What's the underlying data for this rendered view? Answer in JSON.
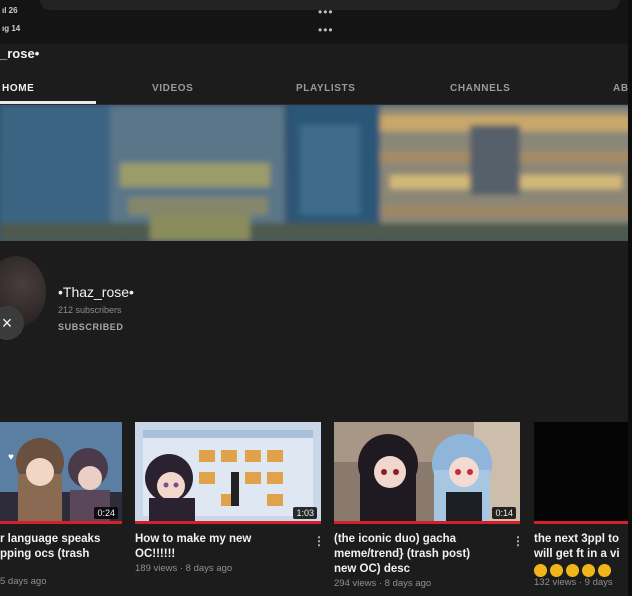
{
  "status": {
    "line1": "ıl 26",
    "line2": "ıg 14",
    "more_label": "•••"
  },
  "channel": {
    "header_title": "_rose•",
    "name": "•Thaz_rose•",
    "subscribers": "212 subscribers",
    "subscription_state": "SUBSCRIBED"
  },
  "tabs": [
    {
      "label": "HOME",
      "active": true
    },
    {
      "label": "VIDEOS",
      "active": false
    },
    {
      "label": "PLAYLISTS",
      "active": false
    },
    {
      "label": "CHANNELS",
      "active": false
    },
    {
      "label": "AB",
      "active": false
    }
  ],
  "close_icon": "×",
  "videos": [
    {
      "title_line1": "r language speaks",
      "title_line2": "pping ocs (trash",
      "meta": "5 days ago",
      "duration": "0:24",
      "watched_fraction": 1.0
    },
    {
      "title_line1": "How to make my new",
      "title_line2": "OC!!!!!!",
      "meta": "189 views · 8 days ago",
      "duration": "1:03",
      "watched_fraction": 1.0
    },
    {
      "title_line1": "(the iconic duo) gacha",
      "title_line2": "meme/trend} (trash post)",
      "title_line3": "new OC) desc",
      "meta": "294 views · 8 days ago",
      "duration": "0:14",
      "watched_fraction": 1.0
    },
    {
      "title_line1": "the next 3ppl to",
      "title_line2": "will get ft in a vi",
      "meta": "132 views · 9 days",
      "emoji_icon": "grimacing-face-emoji",
      "emoji_count": 5,
      "watched_fraction": 1.0
    }
  ],
  "colors": {
    "background": "#1c1c1c",
    "progress": "#d3202a",
    "text_primary": "#f1f1f1",
    "text_secondary": "#8f8f8f"
  }
}
